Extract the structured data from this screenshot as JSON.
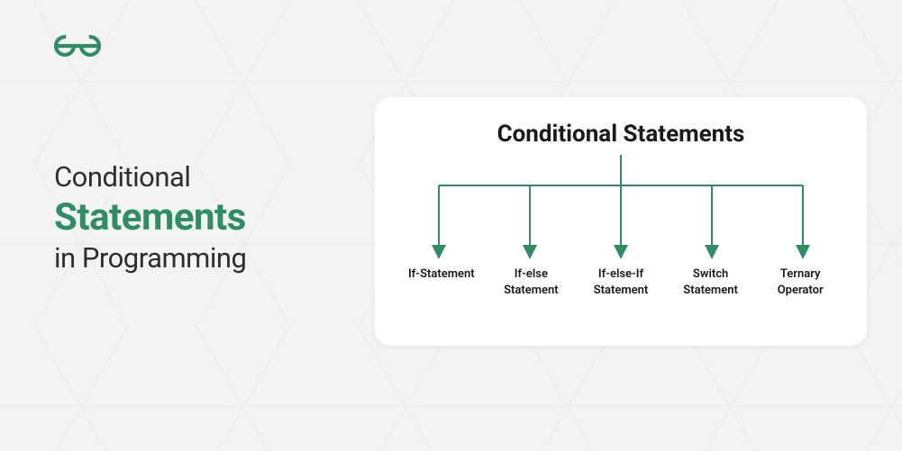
{
  "brand": {
    "name": "geeksforgeeks-logo",
    "color": "#2f8d66"
  },
  "title": {
    "line1": "Conditional",
    "line2": "Statements",
    "line3": "in Programming"
  },
  "diagram": {
    "heading": "Conditional Statements",
    "arrow_color": "#2f8d66",
    "branches": [
      {
        "label_line1": "If-Statement",
        "label_line2": ""
      },
      {
        "label_line1": "If-else",
        "label_line2": "Statement"
      },
      {
        "label_line1": "If-else-If",
        "label_line2": "Statement"
      },
      {
        "label_line1": "Switch",
        "label_line2": "Statement"
      },
      {
        "label_line1": "Ternary",
        "label_line2": "Operator"
      }
    ]
  }
}
